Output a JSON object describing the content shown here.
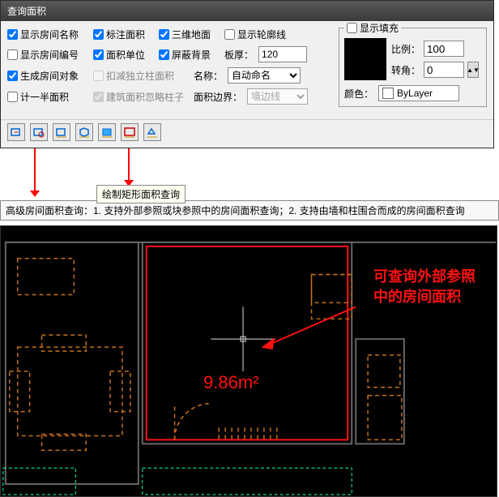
{
  "dialog": {
    "title": "查询面积",
    "checks": {
      "room_name": "显示房间名称",
      "label_area": "标注面积",
      "threed_floor": "三维地面",
      "show_outline": "显示轮廓线",
      "room_number": "显示房间编号",
      "area_unit": "面积单位",
      "mask_bg": "屏蔽背景",
      "gen_room_obj": "生成房间对象",
      "deduct_col": "扣减独立柱面积",
      "half_area": "计一半面积",
      "ignore_col": "建筑面积忽略柱子",
      "show_fill": "显示填充"
    },
    "labels": {
      "slab_thick": "板厚：",
      "name": "名称：",
      "area_bound": "面积边界：",
      "scale": "比例：",
      "rotate": "转角：",
      "color": "颜色："
    },
    "values": {
      "slab_thick": "120",
      "name_sel": "自动命名",
      "bound_sel": "墙边线",
      "scale": "100",
      "rotate": "0",
      "color_sel": "ByLayer"
    }
  },
  "tooltip": "绘制矩形面积查询",
  "info_bar": "高级房间面积查询：1. 支持外部参照或块参照中的房间面积查询；2. 支持由墙和柱围合而成的房间面积查询",
  "cad": {
    "annotation": "可查询外部参照\n中的房间面积",
    "area_value": "9.86m²"
  }
}
